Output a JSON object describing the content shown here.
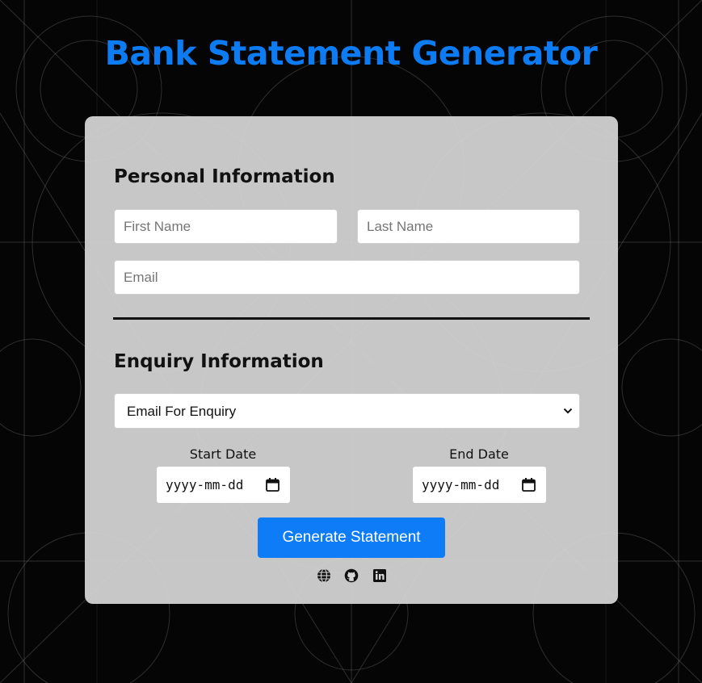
{
  "title": "Bank Statement Generator",
  "personal": {
    "heading": "Personal Information",
    "first_name_placeholder": "First Name",
    "last_name_placeholder": "Last Name",
    "email_placeholder": "Email"
  },
  "enquiry": {
    "heading": "Enquiry Information",
    "select_value": "Email For Enquiry",
    "start_date_label": "Start Date",
    "end_date_label": "End Date",
    "date_placeholder": "yyyy-mm-dd"
  },
  "generate_label": "Generate Statement",
  "social_icons": [
    "globe-icon",
    "github-icon",
    "linkedin-icon"
  ],
  "colors": {
    "accent": "#0d7bf2",
    "card": "#d6d6d6",
    "background": "#050505"
  }
}
